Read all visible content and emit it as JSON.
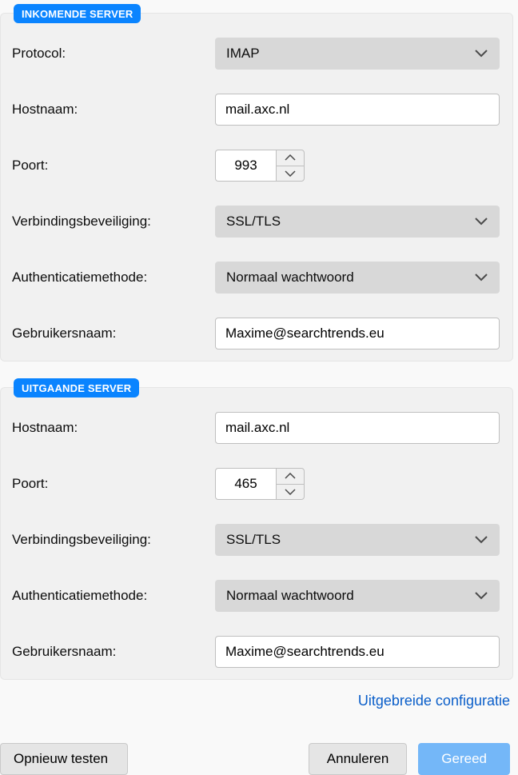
{
  "incoming": {
    "legend": "INKOMENDE SERVER",
    "protocol_label": "Protocol:",
    "protocol_value": "IMAP",
    "hostname_label": "Hostnaam:",
    "hostname_value": "mail.axc.nl",
    "port_label": "Poort:",
    "port_value": "993",
    "conn_sec_label": "Verbindingsbeveiliging:",
    "conn_sec_value": "SSL/TLS",
    "auth_label": "Authenticatiemethode:",
    "auth_value": "Normaal wachtwoord",
    "user_label": "Gebruikersnaam:",
    "user_value": "Maxime@searchtrends.eu"
  },
  "outgoing": {
    "legend": "UITGAANDE SERVER",
    "hostname_label": "Hostnaam:",
    "hostname_value": "mail.axc.nl",
    "port_label": "Poort:",
    "port_value": "465",
    "conn_sec_label": "Verbindingsbeveiliging:",
    "conn_sec_value": "SSL/TLS",
    "auth_label": "Authenticatiemethode:",
    "auth_value": "Normaal wachtwoord",
    "user_label": "Gebruikersnaam:",
    "user_value": "Maxime@searchtrends.eu"
  },
  "advanced_link": "Uitgebreide configuratie",
  "footer": {
    "retest": "Opnieuw testen",
    "cancel": "Annuleren",
    "done": "Gereed"
  }
}
